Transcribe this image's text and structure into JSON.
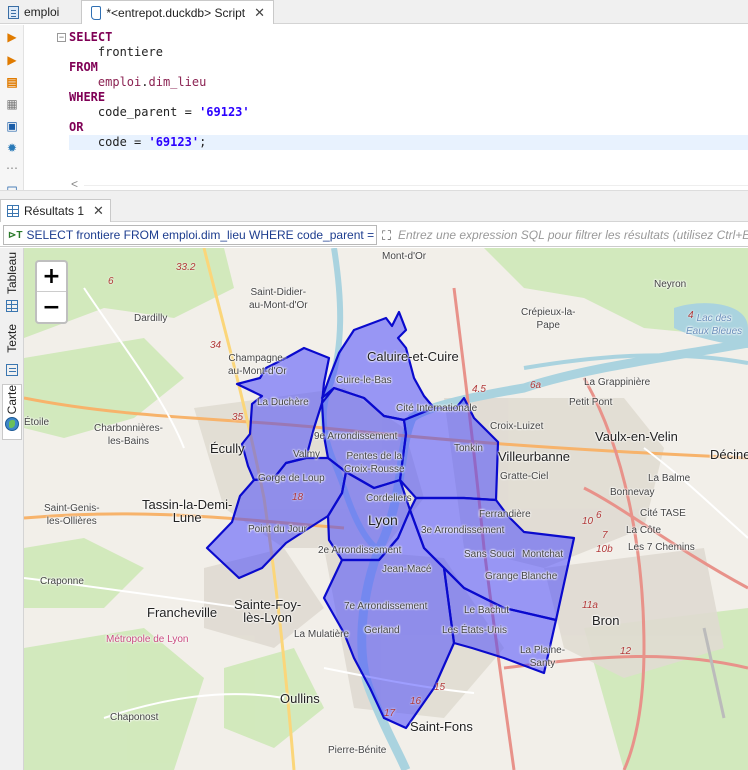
{
  "editor_tabs": [
    {
      "label": "emploi"
    },
    {
      "label": "*<entrepot.duckdb> Script",
      "close": "✕"
    }
  ],
  "sql": {
    "kw_select": "SELECT",
    "col": "frontiere",
    "kw_from": "FROM",
    "schema": "emploi",
    "table": "dim_lieu",
    "kw_where": "WHERE",
    "cond1_left": "code_parent = ",
    "cond1_val": "'69123'",
    "kw_or": "OR",
    "cond2_left": "code = ",
    "cond2_val": "'69123'",
    "cond2_end": ";"
  },
  "results_tab": {
    "label": "Résultats 1",
    "close": "✕"
  },
  "filter_bar": {
    "query": "SELECT frontiere FROM emploi.dim_lieu WHERE code_parent = '69",
    "placeholder": "Entrez une expression SQL pour filtrer les résultats (utilisez Ctrl+Espace)"
  },
  "side_tabs": {
    "tableau": "Tableau",
    "texte": "Texte",
    "carte": "Carte"
  },
  "map": {
    "zoom_in": "+",
    "zoom_out": "−",
    "places": {
      "mont_dor": "Mont-d'Or",
      "saint_didier": "Saint-Didier-\nau-Mont-d'Or",
      "dardilly": "Dardilly",
      "champagne": "Champagne-\nau-Mont-d'Or",
      "caluire": "Caluire-et-Cuire",
      "cuire_le_bas": "Cuire-le-Bas",
      "la_duchere": "La Duchère",
      "cite_internationale": "Cité Internationale",
      "crepieux": "Crépieux-la-\nPape",
      "neyron": "Neyron",
      "la_grappiniere": "La Grappinière",
      "petit_pont": "Petit Pont",
      "croix_luizet": "Croix-Luizet",
      "vaulx": "Vaulx-en-Velin",
      "decines": "Décine",
      "charbonnieres": "Charbonnières-\nles-Bains",
      "etoile": "Étoile",
      "ecully": "Écully",
      "arr9": "9e Arrondissement",
      "valmy": "Valmy",
      "pentes": "Pentes de la\nCroix-Rousse",
      "tonkin": "Tonkin",
      "villeurbanne": "Villeurbanne",
      "gratte_ciel": "Gratte-Ciel",
      "la_balme": "La Balme",
      "gorge_de_loup": "Gorge de Loup",
      "bonnevay": "Bonnevay",
      "saint_genis": "Saint-Genis-\nles-Ollières",
      "tassin": "Tassin-la-Demi-\nLune",
      "cordeliers": "Cordeliers",
      "ferrandiere": "Ferrandière",
      "cite_tase": "Cité TASE",
      "point_du_jour": "Point du Jour",
      "lyon": "Lyon",
      "arr3": "3e Arrondissement",
      "la_cote": "La Côte",
      "les_7_chemins": "Les 7 Chemins",
      "arr2": "2e Arrondissement",
      "sans_souci": "Sans Souci",
      "montchat": "Montchat",
      "jean_mace": "Jean-Macé",
      "grange_blanche": "Grange Blanche",
      "craponne": "Craponne",
      "francheville": "Francheville",
      "sainte_foy": "Sainte-Foy-\nlès-Lyon",
      "arr7": "7e Arrondissement",
      "le_bachut": "Le Bachut",
      "bron": "Bron",
      "metropole": "Métropole de Lyon",
      "gerland": "Gerland",
      "les_etats_unis": "Les États-Unis",
      "la_mulatiere": "La Mulatière",
      "la_plaine_santy": "La Plaine-\nSanty",
      "oullins": "Oullins",
      "chaponost": "Chaponost",
      "saint_fons": "Saint-Fons",
      "pierre_benite": "Pierre-Bénite",
      "lac": "Lac des\nEaux Bleues"
    },
    "roads": [
      "33.2",
      "6",
      "34",
      "35",
      "4.5",
      "6a",
      "4",
      "6",
      "7",
      "10",
      "10b",
      "11a",
      "12",
      "15",
      "16",
      "17",
      "18"
    ]
  },
  "colors": {
    "polygon_fill": "#3d3dff",
    "polygon_stroke": "#0a0acd",
    "map_bg": "#f2efe9",
    "keyword": "#7f0055",
    "string": "#2a00ff"
  }
}
